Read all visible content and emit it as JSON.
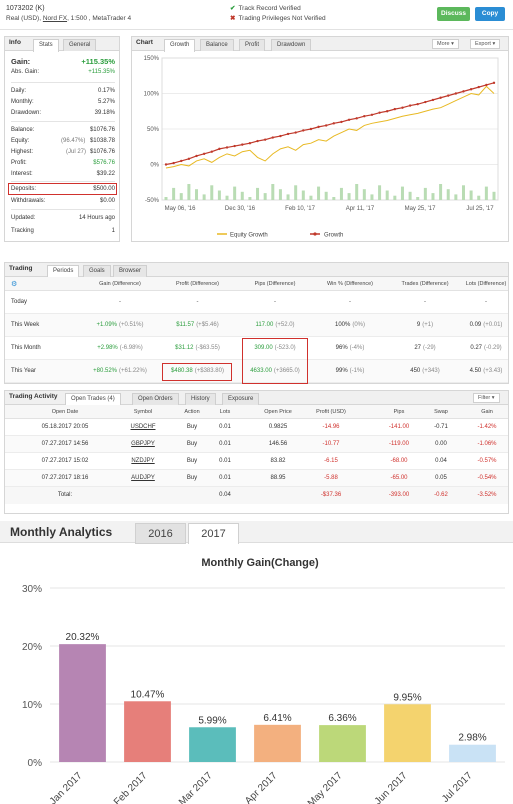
{
  "header": {
    "account_id": "1073202 (K)",
    "account_type": "Real (USD),",
    "broker": "Nord FX",
    "account_rest": ", 1:500 , MetaTrader 4",
    "track_record": "Track Record Verified",
    "trading_privileges": "Trading Privileges Not Verified",
    "discuss_label": "Discuss",
    "copy_label": "Copy",
    "discuss_color": "#5cb85c",
    "copy_color": "#2a8dd4"
  },
  "info": {
    "tab_info": "Info",
    "tab_stats": "Stats",
    "tab_general": "General",
    "gain_label": "Gain:",
    "gain_value": "+115.35%",
    "abs_gain_label": "Abs. Gain:",
    "abs_gain_value": "+115.35%",
    "daily_label": "Daily:",
    "daily_value": "0.17%",
    "monthly_label": "Monthly:",
    "monthly_value": "5.27%",
    "drawdown_label": "Drawdown:",
    "drawdown_value": "39.18%",
    "balance_label": "Balance:",
    "balance_value": "$1076.76",
    "equity_label": "Equity:",
    "equity_pct": "(96.47%)",
    "equity_value": "$1038.78",
    "highest_label": "Highest:",
    "highest_date": "(Jul 27)",
    "highest_value": "$1076.76",
    "profit_label": "Profit:",
    "profit_value": "$576.76",
    "interest_label": "Interest:",
    "interest_value": "$39.22",
    "deposits_label": "Deposits:",
    "deposits_value": "$500.00",
    "withdrawals_label": "Withdrawals:",
    "withdrawals_value": "$0.00",
    "updated_label": "Updated:",
    "updated_value": "14 Hours ago",
    "tracking_label": "Tracking",
    "tracking_value": "1"
  },
  "chart_panel": {
    "tab_chart": "Chart",
    "tab_growth": "Growth",
    "tab_balance": "Balance",
    "tab_profit": "Profit",
    "tab_drawdown": "Drawdown",
    "more_label": "More",
    "export_label": "Export",
    "legend_equity": "Equity Growth",
    "legend_growth": "Growth",
    "equity_color": "#e8b923",
    "growth_color": "#c0392b"
  },
  "growth_chart": {
    "type": "line",
    "y_ticks": [
      "150%",
      "100%",
      "50%",
      "0%",
      "-50%"
    ],
    "ylim": [
      -50,
      150
    ],
    "x_ticks": [
      "May 06, '16",
      "Dec 30, '16",
      "Feb 10, '17",
      "Apr 11, '17",
      "May 25, '17",
      "Jul 25, '17"
    ],
    "growth_series": [
      0,
      2,
      5,
      8,
      12,
      15,
      18,
      22,
      24,
      26,
      28,
      30,
      33,
      35,
      38,
      40,
      43,
      45,
      48,
      50,
      53,
      55,
      58,
      60,
      63,
      65,
      68,
      70,
      73,
      75,
      78,
      80,
      83,
      85,
      88,
      91,
      94,
      97,
      100,
      103,
      106,
      109,
      112,
      115
    ],
    "equity_series": [
      -5,
      -3,
      0,
      -2,
      5,
      8,
      3,
      10,
      15,
      12,
      18,
      20,
      10,
      5,
      15,
      22,
      25,
      20,
      28,
      30,
      35,
      33,
      40,
      45,
      50,
      48,
      55,
      58,
      60,
      62,
      65,
      68,
      70,
      72,
      75,
      78,
      80,
      85,
      90,
      95,
      100,
      98,
      110,
      100
    ]
  },
  "trading": {
    "tab_trading": "Trading",
    "tab_periods": "Periods",
    "tab_goals": "Goals",
    "tab_browser": "Browser",
    "headers": [
      "",
      "Gain (Difference)",
      "Profit (Difference)",
      "Pips (Difference)",
      "Win % (Difference)",
      "Trades (Difference)",
      "Lots (Difference)"
    ],
    "rows": [
      {
        "period": "Today",
        "gain": "-",
        "gain_diff": "",
        "profit": "-",
        "profit_diff": "",
        "pips": "-",
        "pips_diff": "",
        "win": "-",
        "win_diff": "",
        "trades": "-",
        "trades_diff": "",
        "lots": "-",
        "lots_diff": ""
      },
      {
        "period": "This Week",
        "gain": "+1.09%",
        "gain_diff": "(+0.51%)",
        "profit": "$11.57",
        "profit_diff": "(+$5.46)",
        "pips": "117.00",
        "pips_diff": "(+52.0)",
        "win": "100%",
        "win_diff": "(0%)",
        "trades": "9",
        "trades_diff": "(+1)",
        "lots": "0.09",
        "lots_diff": "(+0.01)"
      },
      {
        "period": "This Month",
        "gain": "+2.98%",
        "gain_diff": "(-6.98%)",
        "profit": "$31.12",
        "profit_diff": "(-$63.55)",
        "pips": "309.00",
        "pips_diff": "(-523.0)",
        "win": "96%",
        "win_diff": "(-4%)",
        "trades": "27",
        "trades_diff": "(-29)",
        "lots": "0.27",
        "lots_diff": "(-0.29)"
      },
      {
        "period": "This Year",
        "gain": "+80.52%",
        "gain_diff": "(+61.22%)",
        "profit": "$480.38",
        "profit_diff": "(+$383.80)",
        "pips": "4633.00",
        "pips_diff": "(+3665.0)",
        "win": "99%",
        "win_diff": "(-1%)",
        "trades": "450",
        "trades_diff": "(+343)",
        "lots": "4.50",
        "lots_diff": "(+3.43)"
      }
    ]
  },
  "activity": {
    "tab_activity": "Trading Activity",
    "tab_open_trades": "Open Trades (4)",
    "tab_open_orders": "Open Orders",
    "tab_history": "History",
    "tab_exposure": "Exposure",
    "filter_label": "Filter",
    "headers": [
      "Open Date",
      "Symbol",
      "Action",
      "Lots",
      "Open Price",
      "Profit (USD)",
      "Pips",
      "Swap",
      "Gain"
    ],
    "rows": [
      {
        "date": "05.18.2017 20:05",
        "symbol": "USDCHF",
        "action": "Buy",
        "lots": "0.01",
        "price": "0.9825",
        "profit": "-14.96",
        "pips": "-141.00",
        "swap": "-0.71",
        "gain": "-1.42%"
      },
      {
        "date": "07.27.2017 14:56",
        "symbol": "GBPJPY",
        "action": "Buy",
        "lots": "0.01",
        "price": "146.56",
        "profit": "-10.77",
        "pips": "-119.00",
        "swap": "0.00",
        "gain": "-1.06%"
      },
      {
        "date": "07.27.2017 15:02",
        "symbol": "NZDJPY",
        "action": "Buy",
        "lots": "0.01",
        "price": "83.82",
        "profit": "-6.15",
        "pips": "-68.00",
        "swap": "0.04",
        "gain": "-0.57%"
      },
      {
        "date": "07.27.2017 18:16",
        "symbol": "AUDJPY",
        "action": "Buy",
        "lots": "0.01",
        "price": "88.95",
        "profit": "-5.88",
        "pips": "-65.00",
        "swap": "0.05",
        "gain": "-0.54%"
      }
    ],
    "total_label": "Total:",
    "total_lots": "0.04",
    "total_profit": "-$37.36",
    "total_pips": "-393.00",
    "total_swap": "-0.62",
    "total_gain": "-3.52%"
  },
  "monthly": {
    "title": "Monthly Analytics",
    "tab_2016": "2016",
    "tab_2017": "2017"
  },
  "chart_data": {
    "type": "bar",
    "title": "Monthly Gain(Change)",
    "categories": [
      "Jan 2017",
      "Feb 2017",
      "Mar 2017",
      "Apr 2017",
      "May 2017",
      "Jun 2017",
      "Jul 2017"
    ],
    "values": [
      20.32,
      10.47,
      5.99,
      6.41,
      6.36,
      9.95,
      2.98
    ],
    "value_labels": [
      "20.32%",
      "10.47%",
      "5.99%",
      "6.41%",
      "6.36%",
      "9.95%",
      "2.98%"
    ],
    "colors": [
      "#b685b3",
      "#e67f7a",
      "#5bbdbb",
      "#f3b07f",
      "#bcd879",
      "#f4d36e",
      "#c9e2f5"
    ],
    "y_ticks": [
      "30%",
      "20%",
      "10%",
      "0%"
    ],
    "ylim": [
      0,
      30
    ],
    "grid": true
  }
}
